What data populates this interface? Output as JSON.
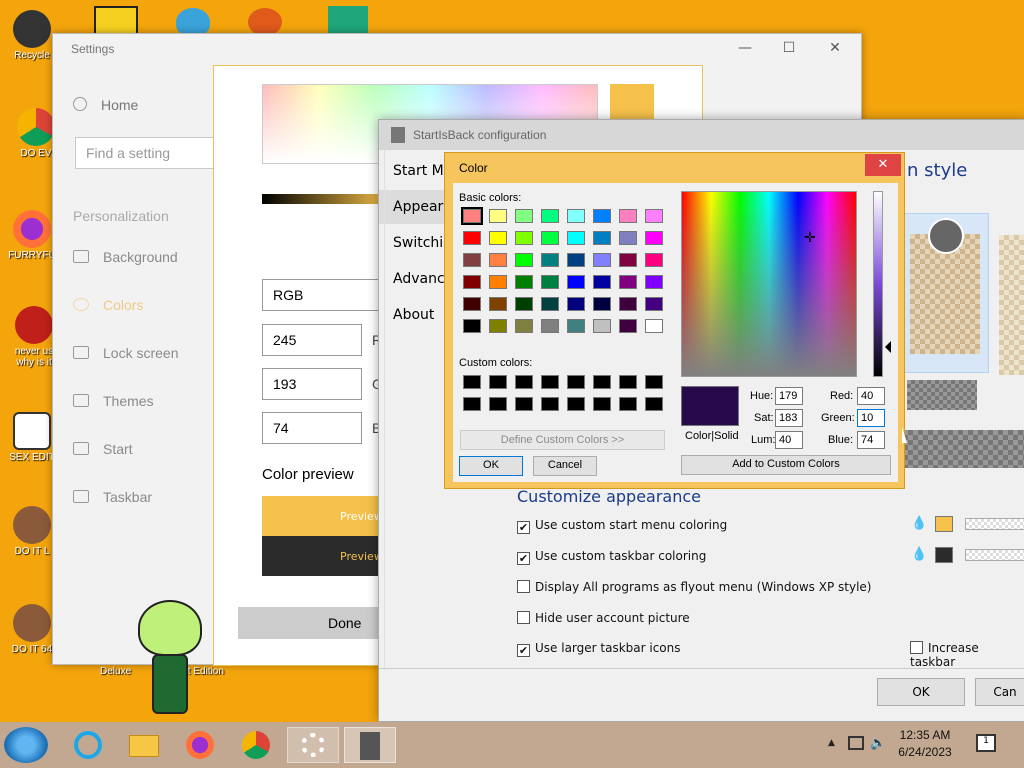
{
  "desktop": {
    "icons": [
      {
        "label": "Recycle"
      },
      {
        "label": "DO EV"
      },
      {
        "label": "FURRYFU"
      },
      {
        "label": "never us\nwhy is it"
      },
      {
        "label": "SEX EDIT"
      },
      {
        "label": "DO IT L"
      },
      {
        "label": "DO IT 64"
      }
    ],
    "bottom_labels": [
      "Deluxe",
      "ait Edition"
    ]
  },
  "settings": {
    "title": "Settings",
    "home": "Home",
    "search_placeholder": "Find a setting",
    "section": "Personalization",
    "nav": [
      "Background",
      "Colors",
      "Lock screen",
      "Themes",
      "Start",
      "Taskbar"
    ],
    "mode": "RGB",
    "r_value": "245",
    "g_value": "193",
    "b_value": "74",
    "r_label": "R",
    "g_label": "G",
    "b_label": "B",
    "preview_title": "Color preview",
    "preview_text": "Preview",
    "done": "Done"
  },
  "sib": {
    "title": "StartIsBack configuration",
    "menu": [
      "Start M",
      "Appeara",
      "Switchi",
      "Advanc",
      "About"
    ],
    "style_heading": "n style",
    "customize_heading": "Customize appearance",
    "options": [
      {
        "label": "Use custom start menu coloring",
        "checked": true
      },
      {
        "label": "Use custom taskbar coloring",
        "checked": true
      },
      {
        "label": "Display All programs as flyout menu (Windows XP style)",
        "checked": false
      },
      {
        "label": "Hide user account picture",
        "checked": false
      },
      {
        "label": "Use larger taskbar icons",
        "checked": true
      }
    ],
    "increase_label": "Increase taskbar",
    "ok": "OK",
    "cancel": "Can"
  },
  "color_dialog": {
    "title": "Color",
    "close": "✕",
    "basic_colors_label": "Basic colors:",
    "custom_colors_label": "Custom colors:",
    "define_custom": "Define Custom Colors >>",
    "ok": "OK",
    "cancel": "Cancel",
    "color_solid": "Color|Solid",
    "hue_label": "Hue:",
    "sat_label": "Sat:",
    "lum_label": "Lum:",
    "red_label": "Red:",
    "green_label": "Green:",
    "blue_label": "Blue:",
    "hue": "179",
    "sat": "183",
    "lum": "40",
    "red": "40",
    "green": "10",
    "blue": "74",
    "add_custom": "Add to Custom Colors",
    "basic_colors": [
      "#ff8080",
      "#ffff80",
      "#80ff80",
      "#00ff80",
      "#80ffff",
      "#0080ff",
      "#ff80c0",
      "#ff80ff",
      "#ff0000",
      "#ffff00",
      "#80ff00",
      "#00ff40",
      "#00ffff",
      "#0080c0",
      "#8080c0",
      "#ff00ff",
      "#804040",
      "#ff8040",
      "#00ff00",
      "#008080",
      "#004080",
      "#8080ff",
      "#800040",
      "#ff0080",
      "#800000",
      "#ff8000",
      "#008000",
      "#008040",
      "#0000ff",
      "#0000a0",
      "#800080",
      "#8000ff",
      "#400000",
      "#804000",
      "#004000",
      "#004040",
      "#000080",
      "#000040",
      "#400040",
      "#400080",
      "#000000",
      "#808000",
      "#808040",
      "#808080",
      "#408080",
      "#c0c0c0",
      "#400040",
      "#ffffff"
    ],
    "current_color": "#280a4a"
  },
  "taskbar": {
    "time": "12:35 AM",
    "date": "6/24/2023",
    "notif_count": "1",
    "apps": [
      "start",
      "ie",
      "explorer",
      "firefox",
      "chrome",
      "settings",
      "startisback"
    ]
  }
}
